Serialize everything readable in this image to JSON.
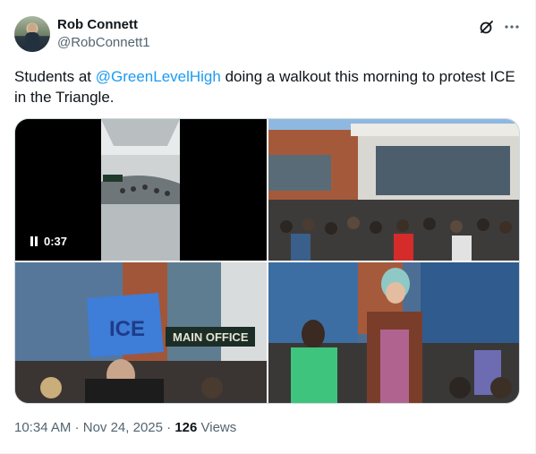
{
  "author": {
    "name": "Rob Connett",
    "handle": "@RobConnett1"
  },
  "header_icons": [
    "grok-icon",
    "more-icon"
  ],
  "tweet": {
    "text_before": "Students at ",
    "mention": "@GreenLevelHigh",
    "text_after": " doing a walkout this morning to protest ICE in the Triangle."
  },
  "media": {
    "video_time": "0:37",
    "tiles": [
      {
        "name": "video-thumbnail-hallway",
        "kind": "video"
      },
      {
        "name": "photo-crowd-outside-school",
        "kind": "photo"
      },
      {
        "name": "photo-student-with-sign",
        "kind": "photo"
      },
      {
        "name": "photo-student-speaking",
        "kind": "photo"
      }
    ],
    "sign_text": "ICE",
    "building_sign": "MAIN OFFICE"
  },
  "footer": {
    "time": "10:34 AM",
    "separator": " · ",
    "date": "Nov 24, 2025",
    "views_count": "126",
    "views_label": " Views"
  },
  "colors": {
    "accent": "#1d9bf0",
    "text": "#0f1419",
    "secondary": "#536471"
  }
}
